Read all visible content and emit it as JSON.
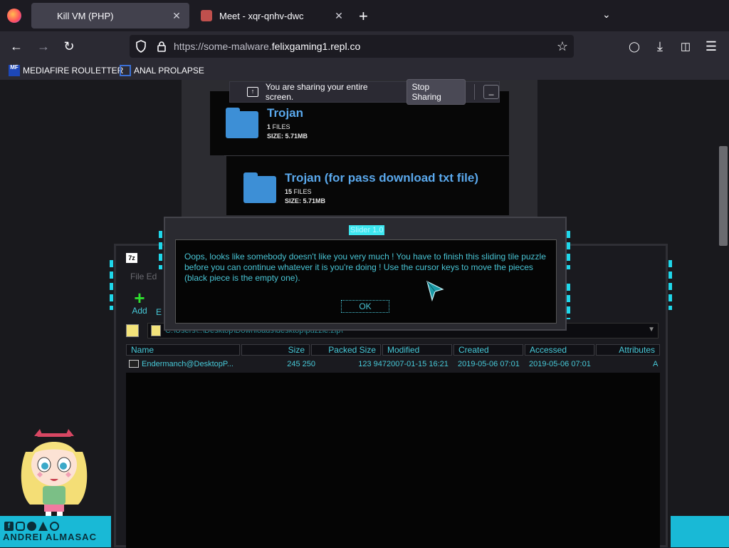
{
  "browser": {
    "tabs": [
      {
        "title": "Kill VM (PHP)",
        "active": true
      },
      {
        "title": "Meet - xqr-qnhv-dwc",
        "active": false
      }
    ],
    "url_prefix": "https://some-malware.",
    "url_host": "felixgaming1.repl.co",
    "bookmarks": [
      {
        "label": "MEDIAFIRE ROULETTER",
        "icon": "mediafire-icon",
        "icon_text": "MF\nT"
      },
      {
        "label": "ANAL PROLAPSE",
        "icon": "bookmark-frame-icon"
      }
    ]
  },
  "sharing_bar": {
    "message": "You are sharing your entire screen.",
    "stop_label": "Stop Sharing",
    "minimize_label": "_"
  },
  "files": [
    {
      "name": "Trojan",
      "files_count": "1",
      "files_label": "FILES",
      "size_label": "SIZE:",
      "size": "5.71MB"
    },
    {
      "name": "Trojan (for pass download txt file)",
      "files_count": "15",
      "files_label": "FILES",
      "size_label": "SIZE:",
      "size": "5.71MB"
    }
  ],
  "sevenzip": {
    "app_icon_text": "7z",
    "menu_fragment": "File  Ed",
    "toolbar_add": "Add",
    "toolbar_more": "E",
    "path": "C:\\Users\\..\\Desktop\\Downloads\\desktop\\puzzle.zip\\",
    "columns": [
      "Name",
      "Size",
      "Packed Size",
      "Modified",
      "Created",
      "Accessed",
      "Attributes"
    ],
    "rows": [
      {
        "name": "Endermanch@DesktopP...",
        "size": "245 250",
        "packed": "123 947",
        "modified": "2007-01-15 16:21",
        "created": "2019-05-06 07:01",
        "accessed": "2019-05-06 07:01",
        "attributes": "A"
      }
    ]
  },
  "slider_dialog": {
    "title": "Slider 1.0",
    "message": "Oops, looks like somebody doesn't like you very much ! You have to finish this sliding tile puzzle before you can continue whatever it is you're doing ! Use the cursor keys to move the pieces (black piece is the empty one).",
    "ok_label": "OK"
  },
  "watermark": {
    "name": "ANDREI ALMASAC",
    "social_icons": [
      "facebook-icon",
      "instagram-icon",
      "discord-icon",
      "gamejolt-icon",
      "twitter-icon"
    ]
  },
  "colors": {
    "accent_cyan": "#1fd7ea",
    "folder_blue": "#3d8fd6",
    "link_blue": "#5aa8ec",
    "dialog_text": "#49c4d4"
  }
}
